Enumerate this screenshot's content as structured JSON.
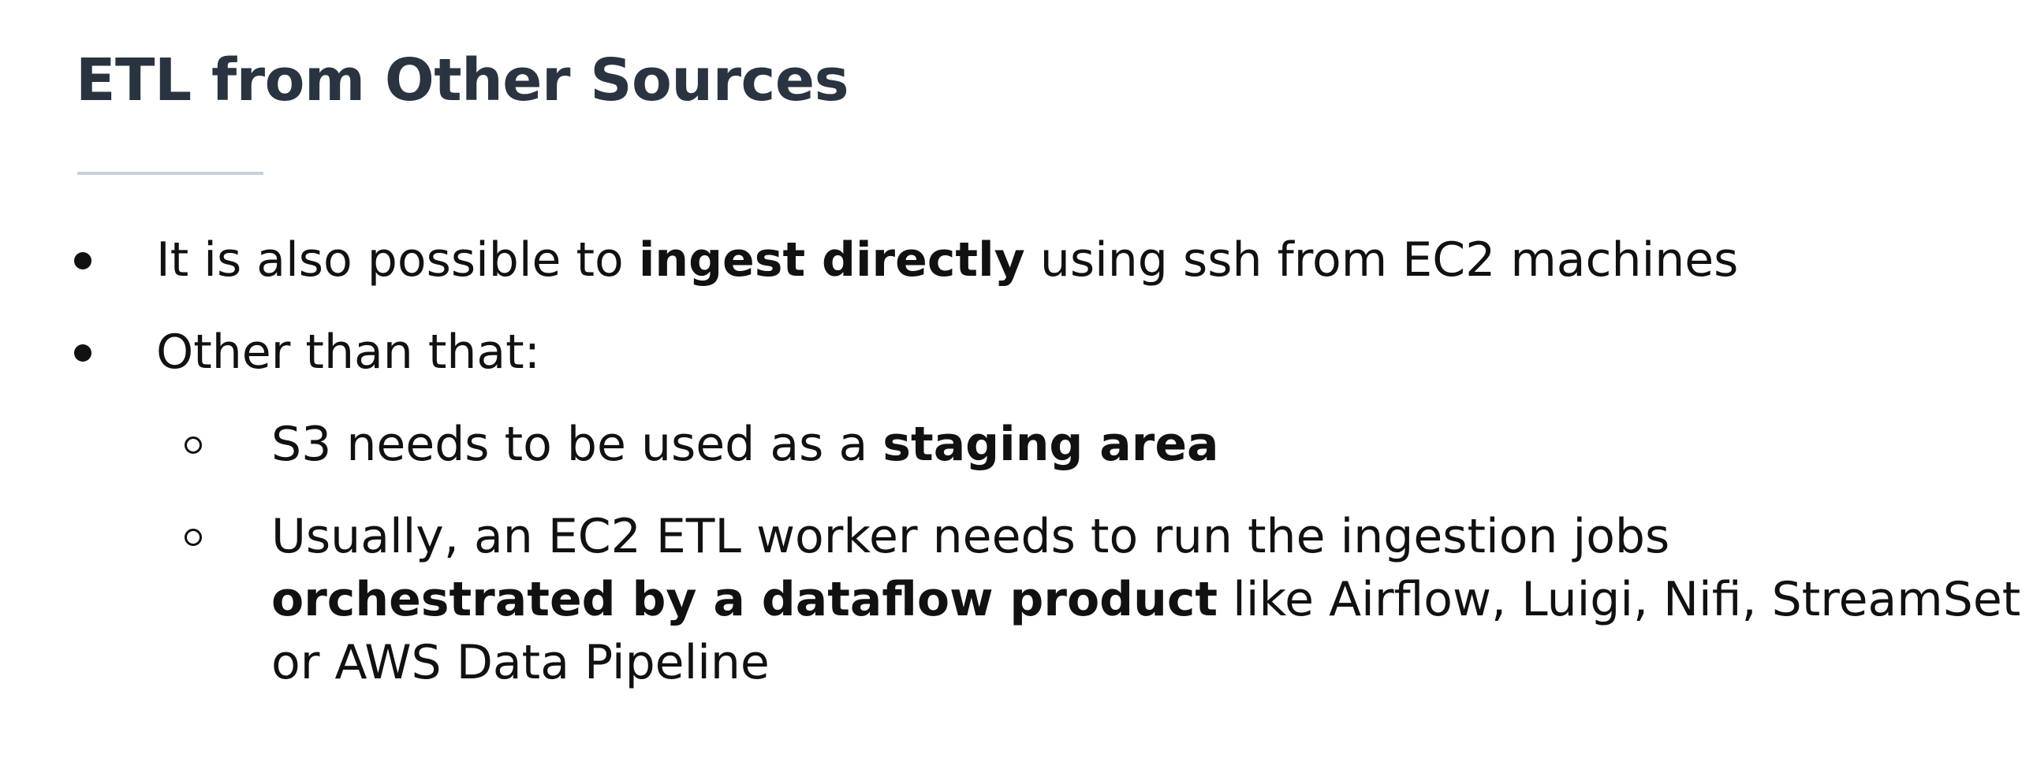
{
  "slide": {
    "title": "ETL from Other Sources",
    "bullets": [
      {
        "level": 1,
        "marker": "filled-circle",
        "pre": "It is also possible to ",
        "bold": "ingest directly",
        "post": " using ssh from EC2 machines"
      },
      {
        "level": 1,
        "marker": "filled-circle",
        "text": "Other than that:"
      },
      {
        "level": 2,
        "marker": "hollow-circle",
        "pre": "S3 needs to be used as a ",
        "bold": "staging area"
      },
      {
        "level": 2,
        "marker": "hollow-circle",
        "line1": "Usually, an EC2 ETL worker needs to run the ingestion jobs",
        "bold": "orchestrated by a dataflow product",
        "line2_post": " like Airflow, Luigi, Nifi, StreamSet",
        "line3": "or AWS Data Pipeline"
      }
    ]
  },
  "colors": {
    "title": "#2a3440",
    "rule": "#c6d2dc",
    "body_text": "#111111",
    "background": "#ffffff"
  }
}
